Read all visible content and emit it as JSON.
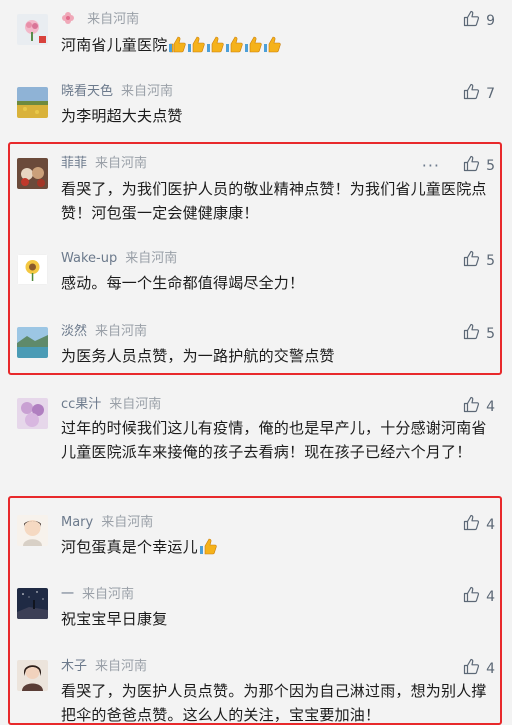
{
  "comments": [
    {
      "nick": "",
      "from": "来自河南",
      "text": "河南省儿童医院",
      "likes": "9",
      "emoji_count": 6
    },
    {
      "nick": "晓看天色",
      "from": "来自河南",
      "text": "为李明超大夫点赞",
      "likes": "7"
    },
    {
      "nick": "菲菲",
      "from": "来自河南",
      "text": "看哭了，为我们医护人员的敬业精神点赞！为我们省儿童医院点赞！河包蛋一定会健健康康！",
      "likes": "5",
      "more": "···"
    },
    {
      "nick": "Wake-up",
      "from": "来自河南",
      "text": "感动。每一个生命都值得竭尽全力！",
      "likes": "5"
    },
    {
      "nick": "淡然",
      "from": "来自河南",
      "text": "为医务人员点赞，为一路护航的交警点赞",
      "likes": "5"
    },
    {
      "nick": "cc果汁",
      "from": "来自河南",
      "text": "过年的时候我们这儿有疫情，俺的也是早产儿，十分感谢河南省儿童医院派车来接俺的孩子去看病！现在孩子已经六个月了！",
      "likes": "4"
    },
    {
      "nick": "Mary",
      "from": "来自河南",
      "text": "河包蛋真是个幸运儿",
      "likes": "4",
      "emoji_count": 1
    },
    {
      "nick": "一",
      "from": "来自河南",
      "text": "祝宝宝早日康复",
      "likes": "4"
    },
    {
      "nick": "木子",
      "from": "来自河南",
      "text": "看哭了，为医护人员点赞。为那个因为自己淋过雨，想为别人撑把伞的爸爸点赞。这么人的关注，宝宝要加油！",
      "likes": "4"
    }
  ],
  "colors": {
    "highlight": "#e8292b",
    "nick": "#6c7a8c",
    "background": "#f3f3f3"
  },
  "icons": {
    "like": "thumbs-up-outline-icon",
    "emoji": "thumbs-up-emoji-icon",
    "nick_badge": "flower-icon"
  }
}
